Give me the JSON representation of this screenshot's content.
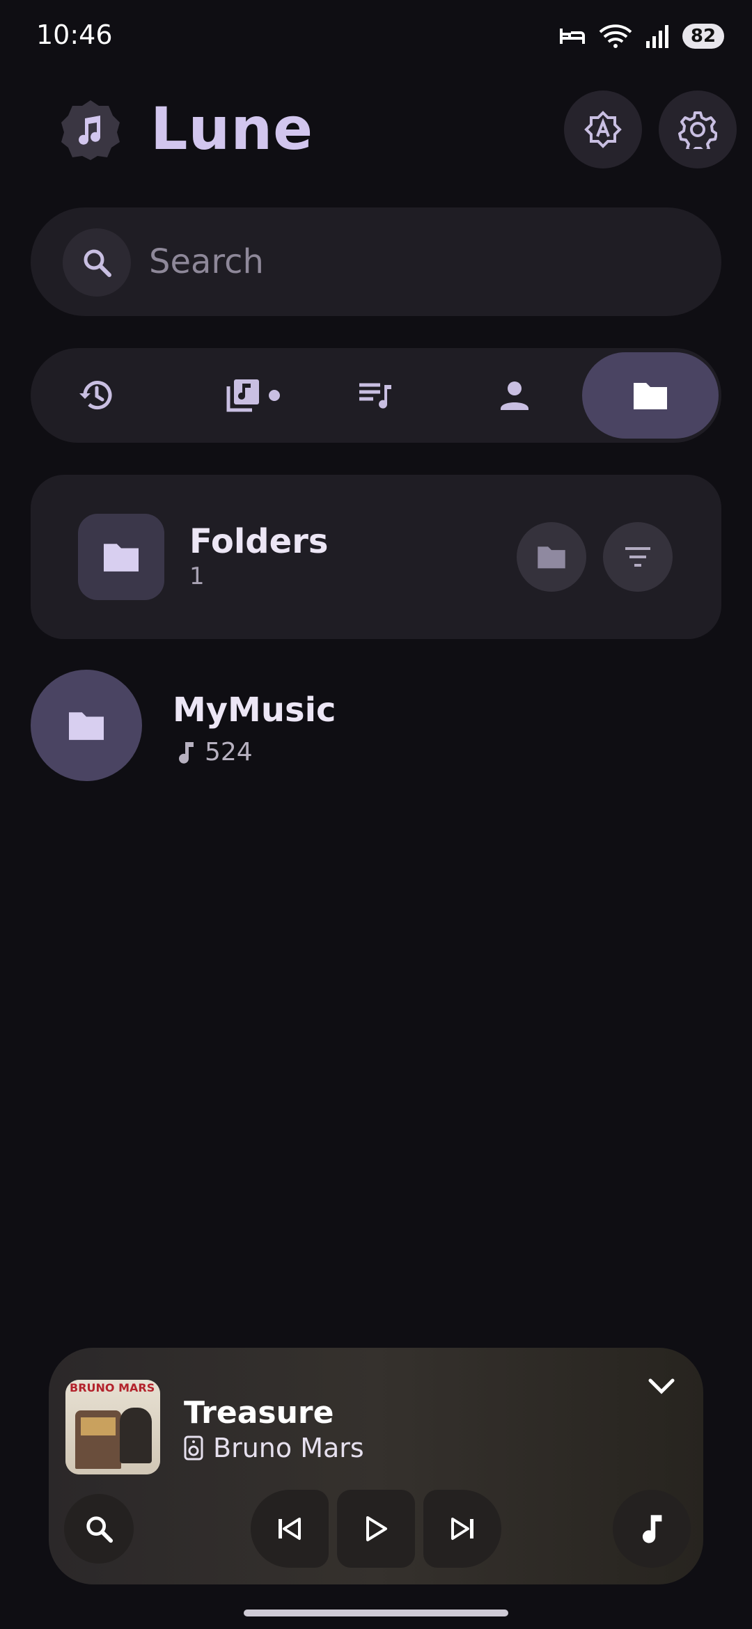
{
  "status_bar": {
    "time": "10:46",
    "battery": "82",
    "icons": [
      "bed-icon",
      "wifi-icon",
      "signal-icon"
    ]
  },
  "header": {
    "app_name": "Lune",
    "logo_icon": "music-note-icon",
    "buttons": [
      "theme-auto-icon",
      "gear-icon"
    ]
  },
  "search": {
    "placeholder": "Search"
  },
  "tabs": [
    {
      "name": "recent",
      "icon": "history-icon",
      "active": false
    },
    {
      "name": "albums",
      "icon": "album-library-icon",
      "active": false,
      "indicator": true
    },
    {
      "name": "playlists",
      "icon": "playlist-icon",
      "active": false
    },
    {
      "name": "artists",
      "icon": "person-icon",
      "active": false
    },
    {
      "name": "folders",
      "icon": "folder-icon",
      "active": true
    }
  ],
  "folders_card": {
    "title": "Folders",
    "count": "1"
  },
  "folders": [
    {
      "name": "MyMusic",
      "tracks": "524"
    }
  ],
  "now_playing": {
    "title": "Treasure",
    "artist": "Bruno Mars",
    "album_art_text": "BRUNO MARS"
  },
  "colors": {
    "background": "#0f0e13",
    "surface": "#1f1d24",
    "accent": "#4a4462",
    "title": "#d2c6ee"
  }
}
